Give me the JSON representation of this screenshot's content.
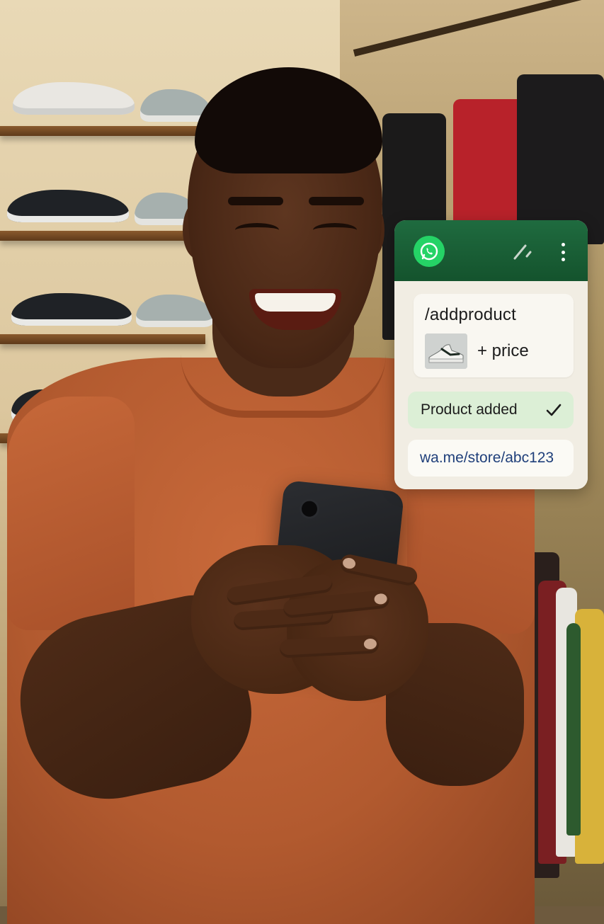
{
  "chat_card": {
    "header": {
      "logo_icon": "whatsapp-logo-icon",
      "edit_icon": "pencil-icon",
      "menu_icon": "vertical-dots-menu-icon",
      "header_color": "#14532d",
      "logo_color": "#25d366"
    },
    "messages": {
      "command": "/addproduct",
      "product_thumbnail_icon": "sneaker-image",
      "price": "+ price",
      "success": "Product added",
      "success_icon": "checkmark-icon",
      "success_color": "#dcefd6",
      "link": "wa.me/store/abc123"
    }
  }
}
